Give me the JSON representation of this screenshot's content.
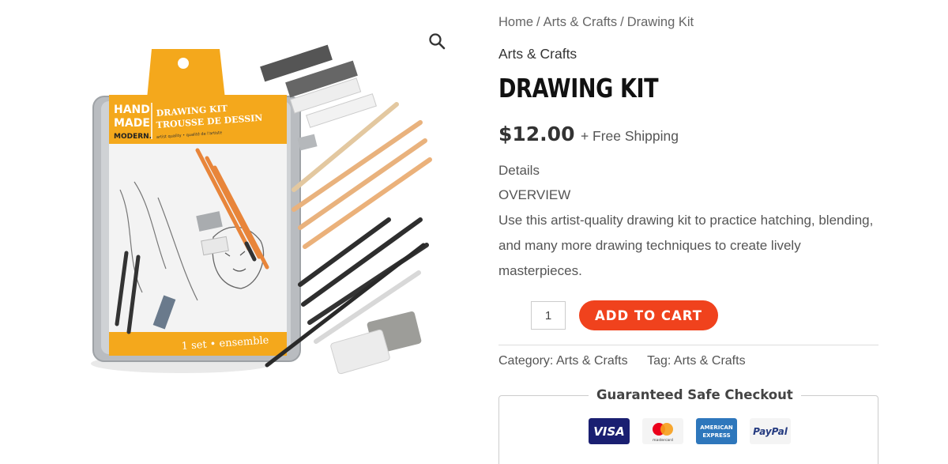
{
  "breadcrumb": {
    "home": "Home",
    "category": "Arts & Crafts",
    "current": "Drawing Kit",
    "separator": "/"
  },
  "product": {
    "brand": "Arts & Crafts",
    "title": "DRAWING KIT",
    "price": "$12.00",
    "shipping": "+ Free Shipping",
    "details_label": "Details",
    "overview_label": "OVERVIEW",
    "description": "Use this artist-quality drawing kit to practice hatching, blending, and many more drawing techniques to create lively masterpieces.",
    "quantity": "1",
    "add_to_cart": "ADD TO CART",
    "category_label": "Category:",
    "category_value": "Arts & Crafts",
    "tag_label": "Tag:",
    "tag_value": "Arts & Crafts"
  },
  "image": {
    "brand_lines": [
      "HAND",
      "MADE",
      "MODERN."
    ],
    "kit_en": "DRAWING KIT",
    "kit_fr": "TROUSSE DE DESSIN",
    "quality": "artist quality • qualité de l'artiste",
    "set": "1 set • ensemble"
  },
  "checkout": {
    "title": "Guaranteed Safe Checkout",
    "visa": "VISA",
    "mastercard": "mastercard",
    "amex_line1": "AMERICAN",
    "amex_line2": "EXPRESS",
    "paypal": "PayPal"
  },
  "icons": {
    "zoom": "search-icon"
  },
  "colors": {
    "accent": "#f0421d",
    "tin_yellow": "#f4a81c",
    "visa_blue": "#1a1f71",
    "amex_blue": "#2e77bc"
  }
}
